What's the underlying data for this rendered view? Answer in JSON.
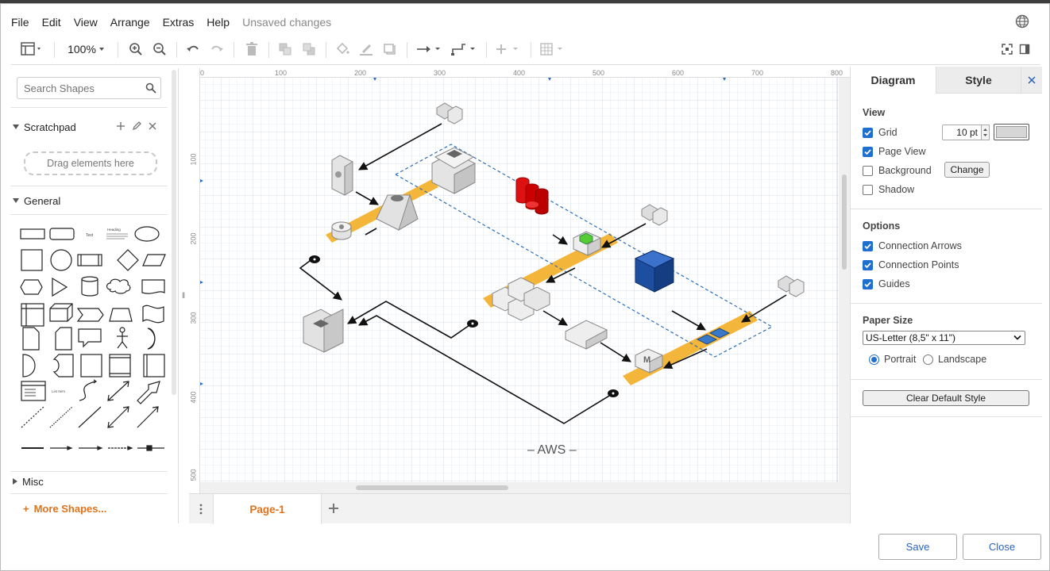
{
  "menu": {
    "file": "File",
    "edit": "Edit",
    "view": "View",
    "arrange": "Arrange",
    "extras": "Extras",
    "help": "Help",
    "status": "Unsaved changes"
  },
  "toolbar": {
    "zoom": "100%"
  },
  "sidebar": {
    "search_placeholder": "Search Shapes",
    "scratchpad": "Scratchpad",
    "drag_hint": "Drag elements here",
    "general": "General",
    "misc": "Misc",
    "more_shapes": "More Shapes..."
  },
  "ruler": {
    "h": [
      "0",
      "100",
      "200",
      "300",
      "400",
      "500",
      "600",
      "700",
      "800"
    ],
    "v": [
      "100",
      "200",
      "300",
      "400",
      "500"
    ]
  },
  "diagram": {
    "caption": "– AWS –"
  },
  "pages": {
    "current": "Page-1"
  },
  "panel": {
    "tab_diagram": "Diagram",
    "tab_style": "Style",
    "view_title": "View",
    "grid": "Grid",
    "grid_size": "10 pt",
    "page_view": "Page View",
    "background": "Background",
    "change": "Change",
    "shadow": "Shadow",
    "options_title": "Options",
    "connection_arrows": "Connection Arrows",
    "connection_points": "Connection Points",
    "guides": "Guides",
    "paper_title": "Paper Size",
    "paper_size": "US-Letter (8,5\" x 11\")",
    "portrait": "Portrait",
    "landscape": "Landscape",
    "clear_style": "Clear Default Style"
  },
  "footer": {
    "save": "Save",
    "close": "Close"
  },
  "colors": {
    "accent": "#e0731b",
    "link": "#2d63b5",
    "checkbox": "#1f6fd0",
    "band": "#f4b63a"
  }
}
